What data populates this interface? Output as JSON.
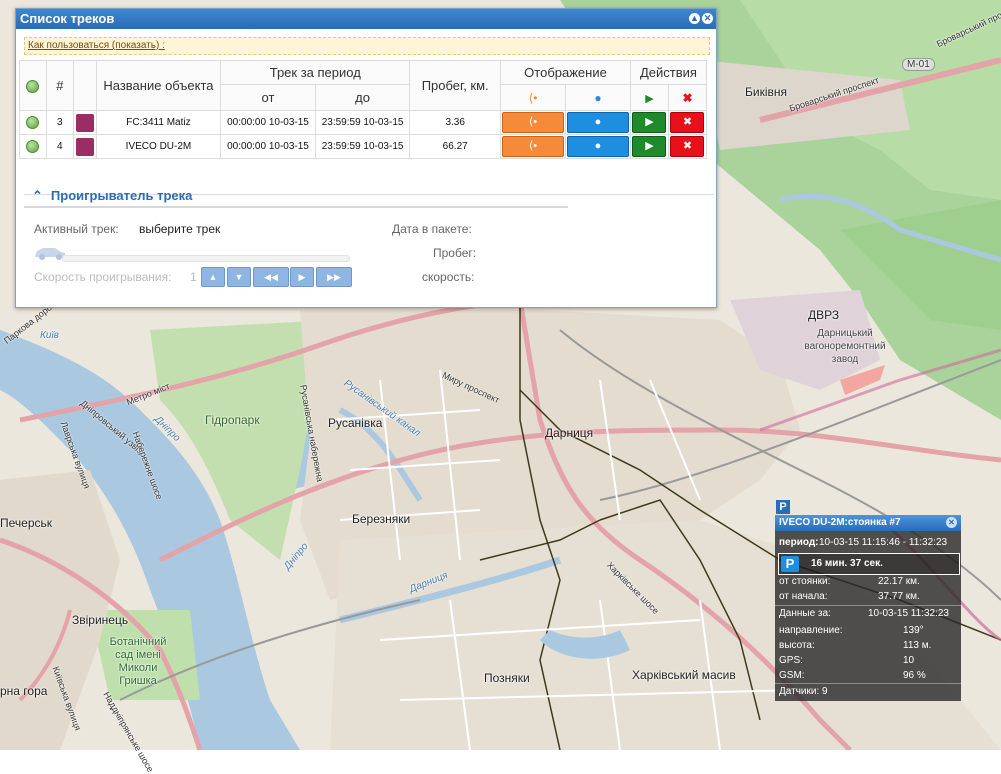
{
  "panel": {
    "title": "Список треков",
    "howto_link": "Как пользоваться (показать) :",
    "headers": {
      "num": "#",
      "name": "Название объекта",
      "period": "Трек за период",
      "from": "от",
      "to": "до",
      "mileage": "Пробег, км.",
      "display": "Отображение",
      "actions": "Действия"
    },
    "rows": [
      {
        "num": "3",
        "name": "FC:3411 Matiz",
        "from": "00:00:00 10-03-15",
        "to": "23:59:59 10-03-15",
        "mileage": "3.36"
      },
      {
        "num": "4",
        "name": "IVECO DU-2M",
        "from": "00:00:00 10-03-15",
        "to": "23:59:59 10-03-15",
        "mileage": "66.27"
      }
    ]
  },
  "player": {
    "title": "Проигрыватель трека",
    "active_label": "Активный трек:",
    "active_value": "выберите трек",
    "speed_label": "Скорость проигрывания:",
    "speed_value": "1",
    "date_label": "Дата в пакете:",
    "mileage_label": "Пробег:",
    "speed2_label": "скорость:"
  },
  "popup": {
    "title": "IVECO DU-2M:стоянка #7",
    "period_label": "период:",
    "period_value": "10-03-15 11:15:46 - 11:32:23",
    "park_icon": "P",
    "duration": "16 мин. 37 сек.",
    "from_stop_label": "от стоянки:",
    "from_stop_value": "22.17 км.",
    "from_start_label": "от начала:",
    "from_start_value": "37.77 км.",
    "data_label": "Данные за:",
    "data_value": "10-03-15 11:32:23",
    "direction_label": "направление:",
    "direction_value": "139°",
    "height_label": "высота:",
    "height_value": "113 м.",
    "gps_label": "GPS:",
    "gps_value": "10",
    "gsm_label": "GSM:",
    "gsm_value": "96 %",
    "sensors_label": "Датчики:",
    "sensors_value": "9",
    "marker": "P"
  },
  "map": {
    "labels": {
      "m01": "М-01",
      "brovary1": "Броварський проспект",
      "brovary2": "Броварський проспект",
      "bykivnia": "Биківня",
      "dvrz": "ДВРЗ",
      "zavod": "Дарницький вагоноремонтний завод",
      "kyiv": "Київ",
      "parkova": "Паркова дорога",
      "dniprovskyi": "Дніпровський узвіз",
      "metro_mist": "Метро міст",
      "lavrska": "Лаврська вулиця",
      "naberezhne": "Набережне шосе",
      "hidropark": "Гідропарк",
      "rusanivka": "Русанівка",
      "rusanivska_nab": "Русанівська набережна",
      "rusanivskyi_kanal": "Русанівський канал",
      "dnipro1": "Дніпро",
      "dnipro2": "Дніпро",
      "myru": "Миру проспект",
      "darnytsia": "Дарниця",
      "darnytsia_river": "Дарниця",
      "bereznyaky": "Березняки",
      "pecherska": "Печерськ",
      "zvirynets": "Звіринець",
      "botsad": "Ботанічний сад імені Миколи Гришка",
      "kharkivske": "Харківське шосе",
      "kharkivskyi": "Харківський масив",
      "pozniaky": "Позняки",
      "tsarna_hora": "рна гора",
      "kyivska_vul": "Київська вулиця",
      "naddniprianske": "Наддніпрянське шосе"
    }
  }
}
